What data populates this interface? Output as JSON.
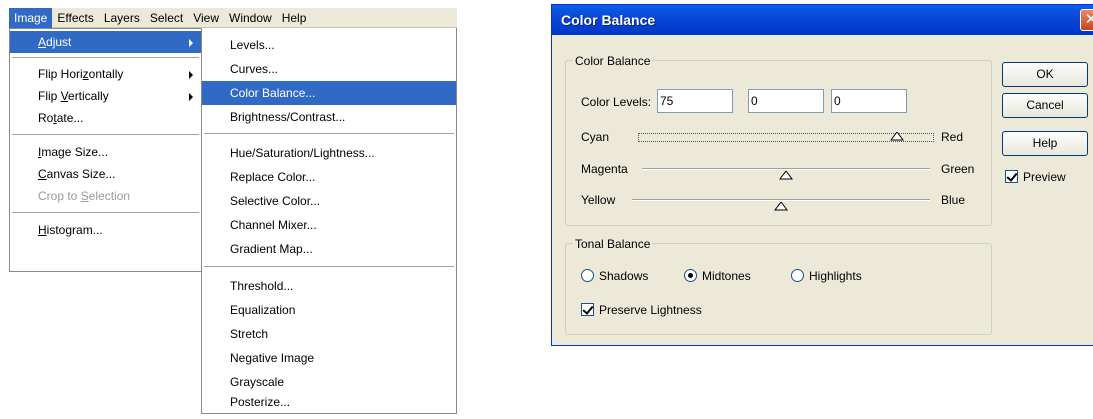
{
  "menubar": {
    "items": [
      "Image",
      "Effects",
      "Layers",
      "Select",
      "View",
      "Window",
      "Help"
    ]
  },
  "image_menu": {
    "items": [
      {
        "label": "Adjust",
        "underline": "A"
      },
      {
        "label": "Flip Horizontally",
        "underline": "z"
      },
      {
        "label": "Flip Vertically",
        "underline": "V"
      },
      {
        "label": "Rotate...",
        "underline": "t"
      },
      {
        "label": "Image Size...",
        "underline": "I"
      },
      {
        "label": "Canvas Size...",
        "underline": "C"
      },
      {
        "label": "Crop to Selection",
        "underline": "S"
      },
      {
        "label": "Histogram...",
        "underline": "H"
      }
    ]
  },
  "adjust_menu": {
    "items": [
      "Levels...",
      "Curves...",
      "Color Balance...",
      "Brightness/Contrast...",
      "Hue/Saturation/Lightness...",
      "Replace Color...",
      "Selective Color...",
      "Channel Mixer...",
      "Gradient Map...",
      "Threshold...",
      "Equalization",
      "Stretch",
      "Negative Image",
      "Grayscale",
      "Posterize..."
    ]
  },
  "dialog": {
    "title": "Color Balance",
    "close_glyph": "✕",
    "color_balance_group": "Color Balance",
    "color_levels_label": "Color Levels:",
    "level_values": [
      "75",
      "0",
      "0"
    ],
    "cyan": "Cyan",
    "red": "Red",
    "magenta": "Magenta",
    "green": "Green",
    "yellow": "Yellow",
    "blue": "Blue",
    "slider_levels": {
      "cyan_red": 75,
      "magenta_green": 0,
      "yellow_blue": 0
    },
    "tonal_group": "Tonal Balance",
    "shadows": "Shadows",
    "midtones": "Midtones",
    "highlights": "Highlights",
    "selected_tone": "Midtones",
    "preserve_lightness": "Preserve Lightness",
    "preserve_checked": true,
    "ok": "OK",
    "cancel": "Cancel",
    "help": "Help",
    "preview": "Preview",
    "preview_checked": true
  },
  "colors": {
    "highlight": "#316ac5",
    "dialog_bg": "#ece9d8",
    "titlebar": "#0a48d6"
  }
}
